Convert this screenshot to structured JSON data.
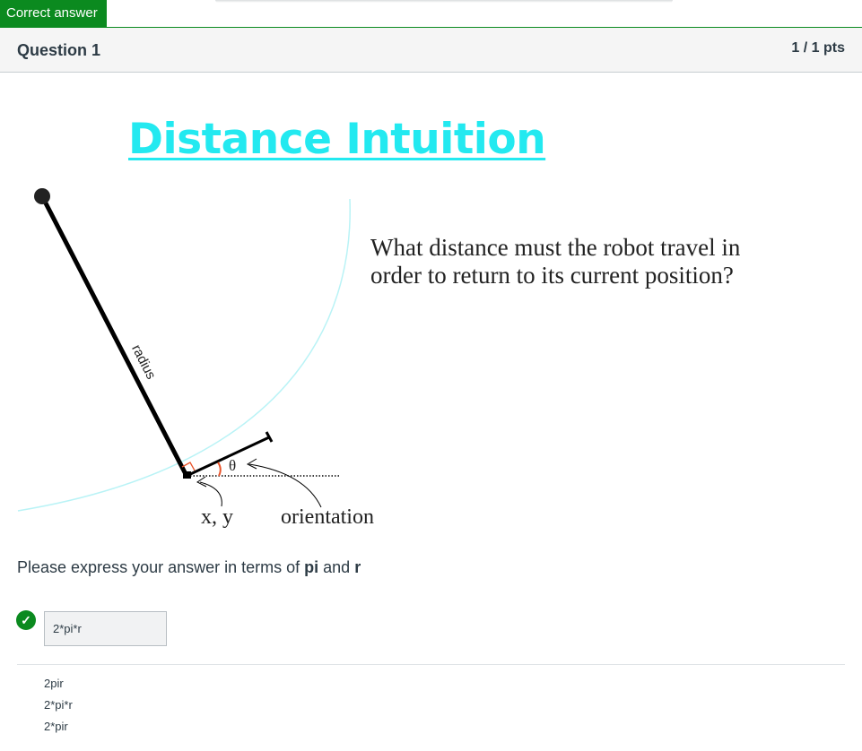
{
  "status_tab": "Correct answer",
  "question": {
    "title": "Question 1",
    "points": "1 / 1 pts"
  },
  "slide": {
    "title": "Distance Intuition",
    "question_text": "What distance must the robot travel in order to return to its current position?",
    "labels": {
      "radius": "radius",
      "theta": "θ",
      "xy": "x, y",
      "orientation": "orientation"
    },
    "colors": {
      "title": "#23e9f0",
      "circle": "#b9f3f6",
      "angle": "#e8542b"
    }
  },
  "instruction": {
    "prefix": "Please express your answer in terms of ",
    "term1": "pi",
    "middle": " and ",
    "term2": "r"
  },
  "answer": {
    "value": "2*pi*r",
    "status_icon": "checkmark-icon"
  },
  "other_answers": [
    "2pir",
    "2*pi*r",
    "2*pir"
  ],
  "colors": {
    "correct": "#0b8a1f",
    "text": "#2d3b45"
  }
}
